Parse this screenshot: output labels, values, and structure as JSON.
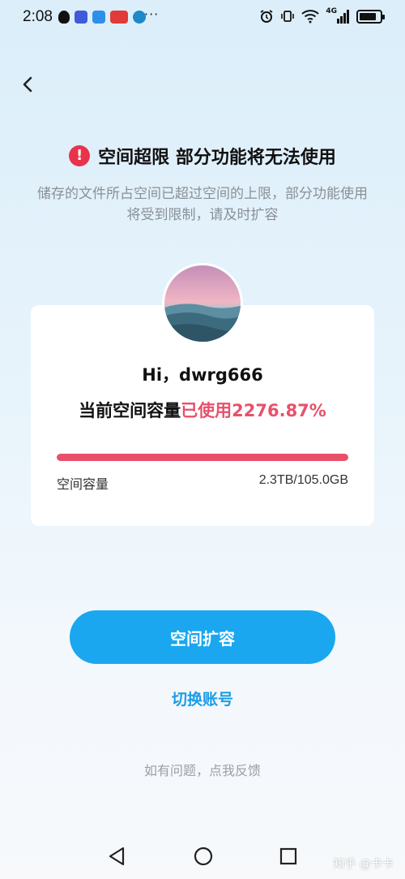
{
  "status_bar": {
    "time": "2:08",
    "more": "···",
    "network": "4G",
    "battery_level": 0.85
  },
  "header": {
    "title": "空间超限 部分功能将无法使用",
    "subtitle": "储存的文件所占空间已超过空间的上限，部分功能使用将受到限制，请及时扩容"
  },
  "card": {
    "greeting": "Hi，dwrg666",
    "usage_label": "当前空间容量",
    "usage_value": "已使用2276.87%",
    "progress_fraction": 1.0,
    "capacity_label": "空间容量",
    "capacity_value": "2.3TB/105.0GB"
  },
  "actions": {
    "expand_button": "空间扩容",
    "switch_account": "切换账号",
    "feedback": "如有问题，点我反馈"
  },
  "footer": {
    "watermark": "知乎 @卡卡"
  },
  "colors": {
    "accent": "#1aa7f0",
    "danger": "#e8506a",
    "link": "#1a9ce6"
  }
}
